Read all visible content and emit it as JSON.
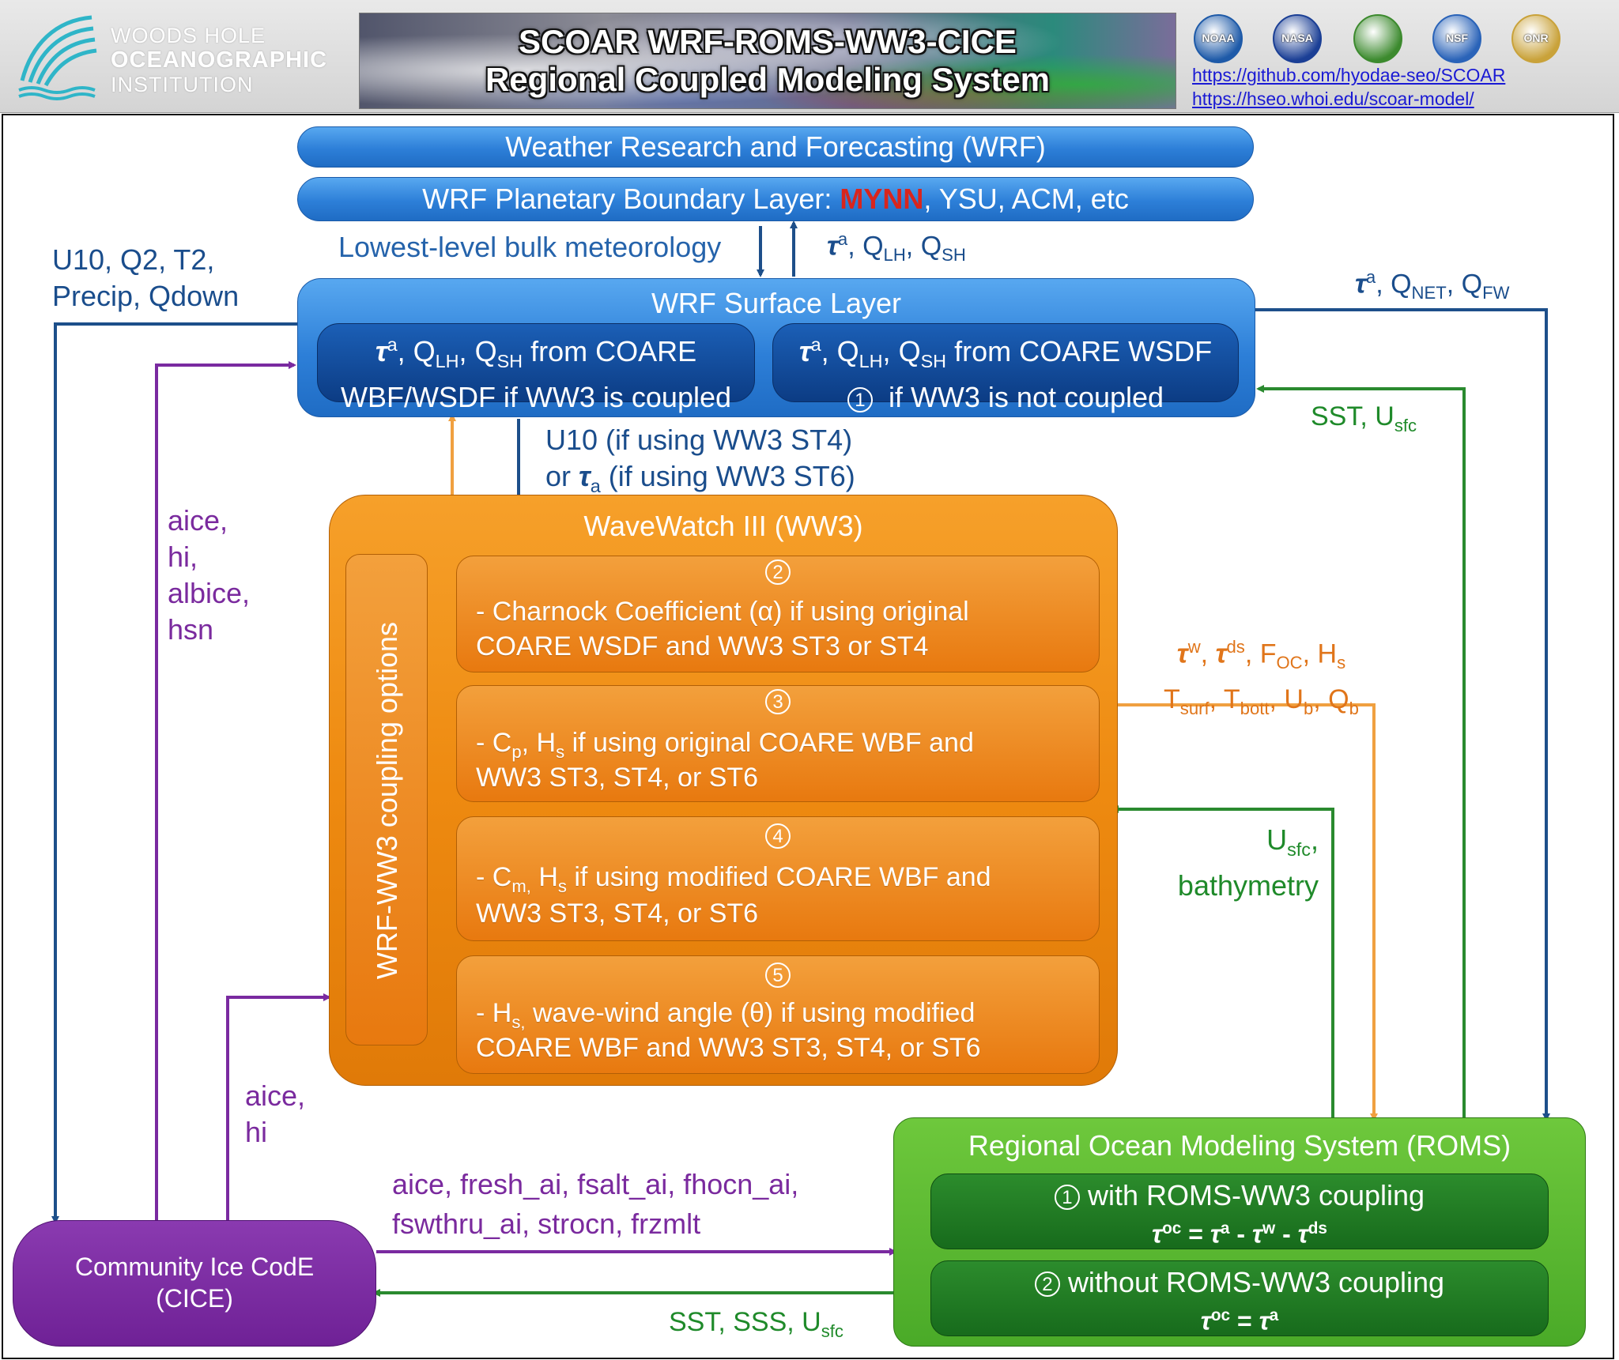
{
  "header": {
    "org_logo": {
      "icon": "whoi-wave-logo-icon",
      "line1": "WOODS HOLE",
      "line2": "OCEANOGRAPHIC",
      "line3": "INSTITUTION"
    },
    "banner_title_line1": "SCOAR WRF-ROMS-WW3-CICE",
    "banner_title_line2": "Regional Coupled Modeling System",
    "agency_logos": [
      {
        "name": "noaa-logo-icon",
        "text": "NOAA",
        "color": "#1e5aa8"
      },
      {
        "name": "nasa-logo-icon",
        "text": "NASA",
        "color": "#1b3f95"
      },
      {
        "name": "doe-logo-icon",
        "text": "",
        "color": "#3c8a2e"
      },
      {
        "name": "nsf-logo-icon",
        "text": "NSF",
        "color": "#2a63b8"
      },
      {
        "name": "onr-logo-icon",
        "text": "ONR",
        "color": "#c9a23a"
      }
    ],
    "link1": "https://github.com/hyodae-seo/SCOAR",
    "link2": "https://hseo.whoi.edu/scoar-model/"
  },
  "wrf": {
    "title": "Weather Research and Forecasting (WRF)",
    "pbl_prefix": "WRF Planetary Boundary Layer:",
    "pbl_highlight": "MYNN",
    "pbl_suffix": ", YSU, ACM, etc",
    "surface_title": "WRF  Surface Layer",
    "sl_left": {
      "sym": "τ",
      "sup": "a",
      "q1": "Q",
      "q1sub": "LH",
      "q2": "Q",
      "q2sub": "SH",
      "text1": "from COARE",
      "line2": "WBF/WSDF if WW3 is coupled"
    },
    "sl_right": {
      "sym": "τ",
      "sup": "a",
      "q1": "Q",
      "q1sub": "LH",
      "q2": "Q",
      "q2sub": "SH",
      "text1": "from COARE WSDF",
      "num": "1",
      "line2": "if WW3 is not coupled"
    }
  },
  "labels": {
    "bulk_met": "Lowest-level bulk meteorology",
    "flux_up": {
      "sym": "τ",
      "sup": "a",
      "sep1": ", Q",
      "s1": "LH",
      "sep2": ", Q",
      "s2": "SH"
    },
    "u10_line1": "U10, Q2, T2,",
    "u10_line2": "Precip, Qdown",
    "flux_right": {
      "sym": "τ",
      "sup": "a",
      "sep1": ", Q",
      "s1": "NET",
      "sep2": ", Q",
      "s2": "FW"
    },
    "sst_usfc": {
      "text": "SST, U",
      "sub": "sfc"
    },
    "u10_ww3_line1": "U10 (if using WW3 ST4)",
    "u10_ww3_line2_pre": "or ",
    "u10_ww3_sym": "τ",
    "u10_ww3_sub": "a",
    "u10_ww3_line2_post": " (if using WW3 ST6)",
    "cice_up": [
      "aice,",
      "hi,",
      "albice,",
      "hsn"
    ],
    "cice_ww3": [
      "aice,",
      "hi"
    ],
    "ww3_out_line1": {
      "t1": "τ",
      "s1": "w",
      "sep": ", ",
      "t2": "τ",
      "s2": "ds",
      "rest": ", F",
      "r1": "OC",
      "r2": ", H",
      "r3": "s"
    },
    "ww3_out_line2": {
      "a": "T",
      "as": "surf",
      "b": ", T",
      "bs": "bott",
      "c": ", U",
      "cs": "b",
      "d": ", Q",
      "ds": "b"
    },
    "usfc_bathy_line1": {
      "text": "U",
      "sub": "sfc",
      "tail": ","
    },
    "usfc_bathy_line2": "bathymetry",
    "cice_roms_line1": "aice, fresh_ai, fsalt_ai, fhocn_ai,",
    "cice_roms_line2": "fswthru_ai, strocn, frzmlt",
    "roms_cice": {
      "text": "SST, SSS, U",
      "sub": "sfc"
    }
  },
  "ww3": {
    "title": "WaveWatch III (WW3)",
    "side_label": "WRF-WW3 coupling options",
    "options": [
      {
        "num": "2",
        "line1": "- Charnock Coefficient (α) if using original",
        "line2": "COARE WSDF and WW3 ST3 or ST4"
      },
      {
        "num": "3",
        "line1": "- C",
        "l1sub": "p",
        "l1mid": ", H",
        "l1sub2": "s",
        "l1rest": " if using original COARE WBF and",
        "line2": "WW3 ST3, ST4, or ST6"
      },
      {
        "num": "4",
        "line1": "- C",
        "l1sub": "m,",
        "l1mid": " H",
        "l1sub2": "s",
        "l1rest": "  if using modified COARE WBF and",
        "line2": "WW3 ST3, ST4, or ST6"
      },
      {
        "num": "5",
        "line1": "- H",
        "l1sub": "s,",
        "l1rest": " wave-wind angle (θ) if using modified",
        "line2": "COARE WBF and WW3 ST3, ST4, or ST6"
      }
    ]
  },
  "roms": {
    "title": "Regional Ocean Modeling System (ROMS)",
    "opt1": {
      "num": "1",
      "text": "with ROMS-WW3 coupling",
      "eq": {
        "l": "τ",
        "ls": "oc",
        "m": " = ",
        "a": "τ",
        "as": "a",
        "b": " - ",
        "w": "τ",
        "ws": "w",
        "c": " - ",
        "d": "τ",
        "dsup": "ds"
      }
    },
    "opt2": {
      "num": "2",
      "text": "without  ROMS-WW3 coupling",
      "eq": {
        "l": "τ",
        "ls": "oc",
        "m": " = ",
        "a": "τ",
        "as": "a"
      }
    }
  },
  "cice": {
    "line1": "Community Ice CodE",
    "line2": "(CICE)"
  },
  "colors": {
    "navy_arrow": "#1d4f8a",
    "green_arrow": "#2a8a2f",
    "orange_arrow": "#f0a040",
    "purple_arrow": "#7a2aa0",
    "mynn_red": "#d9251d"
  }
}
